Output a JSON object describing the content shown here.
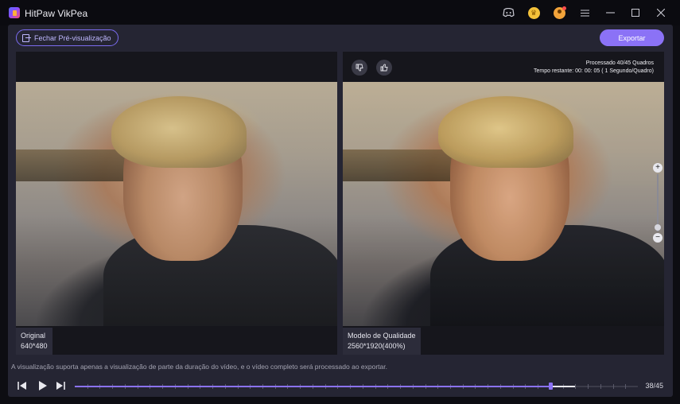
{
  "window": {
    "title": "HitPaw VikPea"
  },
  "titlebar_icons": [
    "discord-icon",
    "coin-icon",
    "user-avatar-icon",
    "menu-icon",
    "minimize-icon",
    "maximize-icon",
    "close-icon"
  ],
  "toolbar": {
    "close_preview_label": "Fechar Pré-visualização",
    "export_label": "Exportar"
  },
  "preview": {
    "original": {
      "label": "Original",
      "resolution": "640*480"
    },
    "enhanced": {
      "label": "Modelo de Qualidade",
      "resolution": "2560*1920(400%)"
    },
    "progress_line1": "Processado 40/45 Quadros",
    "progress_line2": "Tempo restante: 00: 00: 05 ( 1 Segundo/Quadro)"
  },
  "notice": "A visualização suporta apenas a visualização de parte da duração do vídeo, e o vídeo completo será processado ao exportar.",
  "playback": {
    "frame_counter": "38/45",
    "current_frame": 38,
    "processed_frames": 40,
    "total_frames": 45
  },
  "colors": {
    "accent": "#8b72f6",
    "background": "#252533"
  }
}
